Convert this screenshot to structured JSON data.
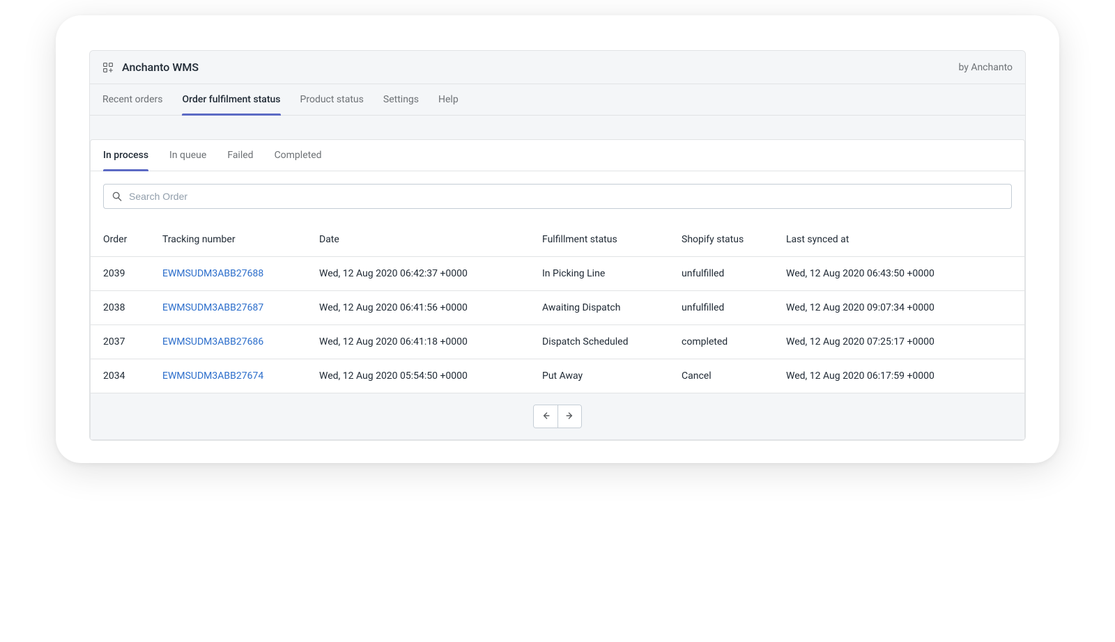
{
  "header": {
    "title": "Anchanto WMS",
    "byline": "by Anchanto"
  },
  "primary_tabs": [
    {
      "label": "Recent orders",
      "active": false
    },
    {
      "label": "Order fulfilment status",
      "active": true
    },
    {
      "label": "Product status",
      "active": false
    },
    {
      "label": "Settings",
      "active": false
    },
    {
      "label": "Help",
      "active": false
    }
  ],
  "sub_tabs": [
    {
      "label": "In process",
      "active": true
    },
    {
      "label": "In queue",
      "active": false
    },
    {
      "label": "Failed",
      "active": false
    },
    {
      "label": "Completed",
      "active": false
    }
  ],
  "search": {
    "placeholder": "Search Order",
    "value": ""
  },
  "table": {
    "columns": [
      "Order",
      "Tracking number",
      "Date",
      "Fulfillment status",
      "Shopify status",
      "Last synced at"
    ],
    "rows": [
      {
        "order": "2039",
        "tracking": "EWMSUDM3ABB27688",
        "date": "Wed, 12 Aug 2020 06:42:37 +0000",
        "fulfillment": "In Picking Line",
        "shopify": "unfulfilled",
        "synced": "Wed, 12 Aug 2020 06:43:50 +0000"
      },
      {
        "order": "2038",
        "tracking": "EWMSUDM3ABB27687",
        "date": "Wed, 12 Aug 2020 06:41:56 +0000",
        "fulfillment": "Awaiting Dispatch",
        "shopify": "unfulfilled",
        "synced": "Wed, 12 Aug 2020 09:07:34 +0000"
      },
      {
        "order": "2037",
        "tracking": "EWMSUDM3ABB27686",
        "date": "Wed, 12 Aug 2020 06:41:18 +0000",
        "fulfillment": "Dispatch Scheduled",
        "shopify": "completed",
        "synced": "Wed, 12 Aug 2020 07:25:17 +0000"
      },
      {
        "order": "2034",
        "tracking": "EWMSUDM3ABB27674",
        "date": "Wed, 12 Aug 2020 05:54:50 +0000",
        "fulfillment": "Put Away",
        "shopify": "Cancel",
        "synced": "Wed, 12 Aug 2020 06:17:59 +0000"
      }
    ]
  }
}
